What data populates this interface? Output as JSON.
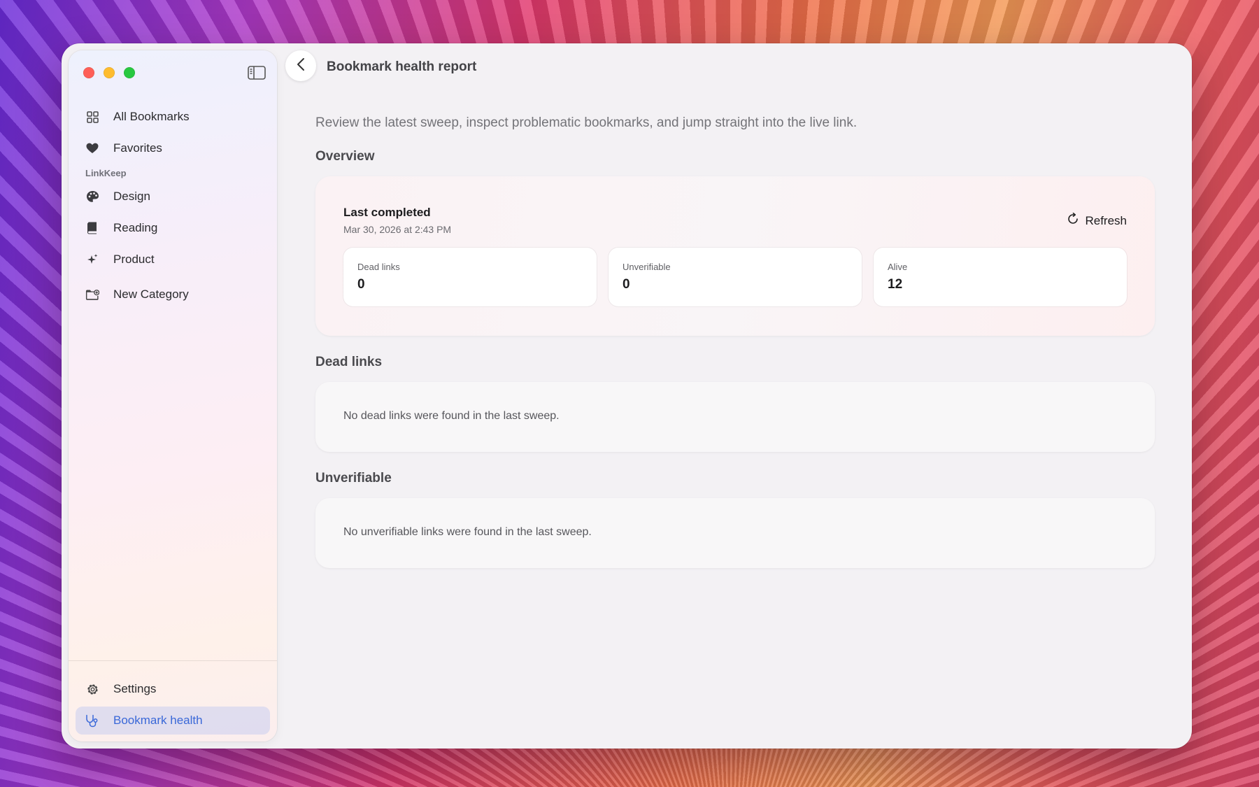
{
  "sidebar": {
    "items": [
      {
        "label": "All Bookmarks",
        "icon": "grid-icon"
      },
      {
        "label": "Favorites",
        "icon": "heart-icon"
      }
    ],
    "section_label": "LinkKeep",
    "categories": [
      {
        "label": "Design",
        "icon": "palette-icon"
      },
      {
        "label": "Reading",
        "icon": "book-icon"
      },
      {
        "label": "Product",
        "icon": "sparkles-icon"
      }
    ],
    "new_category": "New Category",
    "settings": "Settings",
    "bookmark_health": "Bookmark health"
  },
  "header": {
    "title": "Bookmark health report"
  },
  "main": {
    "subtitle": "Review the latest sweep, inspect problematic bookmarks, and jump straight into the live link.",
    "overview": {
      "heading": "Overview",
      "last_completed_label": "Last completed",
      "last_completed_date": "Mar 30, 2026 at 2:43 PM",
      "refresh_label": "Refresh",
      "stats": [
        {
          "label": "Dead links",
          "value": "0"
        },
        {
          "label": "Unverifiable",
          "value": "0"
        },
        {
          "label": "Alive",
          "value": "12"
        }
      ]
    },
    "dead_links": {
      "heading": "Dead links",
      "empty_message": "No dead links were found in the last sweep."
    },
    "unverifiable": {
      "heading": "Unverifiable",
      "empty_message": "No unverifiable links were found in the last sweep."
    }
  },
  "colors": {
    "accent": "#3a68d8",
    "active_bg": "#d8dbf3",
    "traffic_red": "#fe5f57",
    "traffic_yellow": "#febc2e",
    "traffic_green": "#28c840"
  }
}
